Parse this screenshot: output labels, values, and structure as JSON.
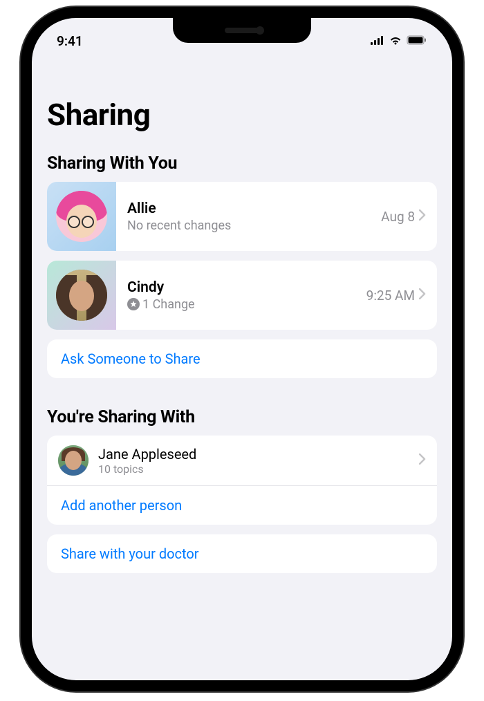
{
  "status": {
    "time": "9:41"
  },
  "page": {
    "title": "Sharing"
  },
  "sections": {
    "withYou": {
      "title": "Sharing With You",
      "people": [
        {
          "name": "Allie",
          "subtitle": "No recent changes",
          "meta": "Aug 8",
          "hasBadge": false
        },
        {
          "name": "Cindy",
          "subtitle": "1 Change",
          "meta": "9:25 AM",
          "hasBadge": true
        }
      ],
      "askLink": "Ask Someone to Share"
    },
    "youShare": {
      "title": "You're Sharing With",
      "people": [
        {
          "name": "Jane Appleseed",
          "subtitle": "10 topics"
        }
      ],
      "addLink": "Add another person",
      "doctorLink": "Share with your doctor"
    }
  }
}
